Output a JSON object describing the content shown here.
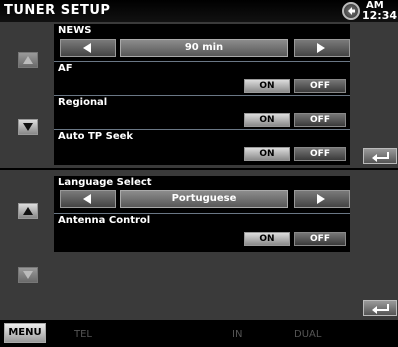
{
  "header": {
    "title": "TUNER SETUP",
    "clock_ampm": "AM",
    "clock_time": "12:34"
  },
  "panel1": {
    "rows": [
      {
        "label": "NEWS",
        "value": "90 min"
      },
      {
        "label": "AF",
        "on": "ON",
        "off": "OFF"
      },
      {
        "label": "Regional",
        "on": "ON",
        "off": "OFF"
      },
      {
        "label": "Auto TP Seek",
        "on": "ON",
        "off": "OFF"
      }
    ]
  },
  "panel2": {
    "rows": [
      {
        "label": "Language Select",
        "value": "Portuguese"
      },
      {
        "label": "Antenna Control",
        "on": "ON",
        "off": "OFF"
      }
    ]
  },
  "footer": {
    "menu_label": "MENU",
    "indicators": [
      "TEL",
      "IN",
      "DUAL"
    ]
  }
}
